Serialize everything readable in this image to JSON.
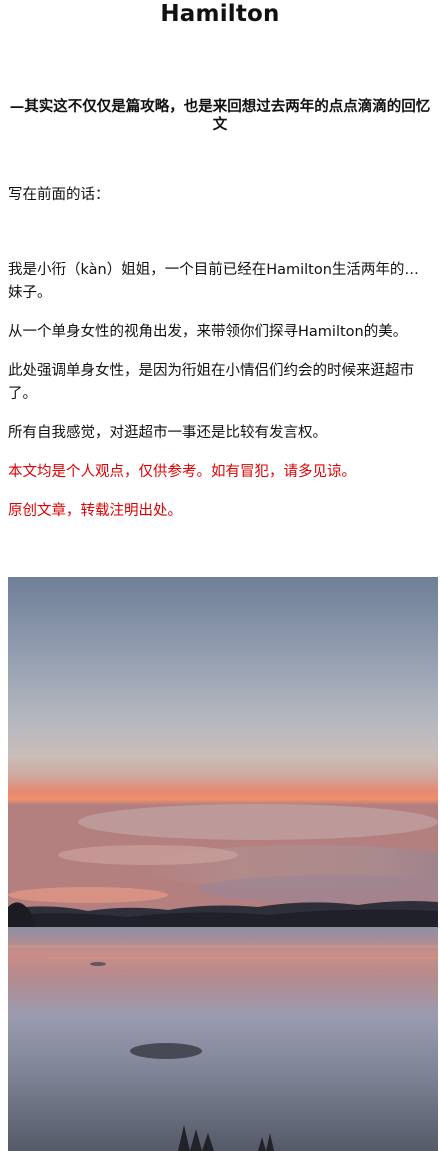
{
  "article": {
    "title": "Hamilton",
    "subtitle": "—其实这不仅仅是篇攻略，也是来回想过去两年的点点滴滴的回忆文",
    "paragraphs": [
      "写在前面的话：",
      "我是小衎（kàn）姐姐，一个目前已经在Hamilton生活两年的…妹子。",
      "从一个单身女性的视角出发，来带领你们探寻Hamilton的美。",
      "此处强调单身女性，是因为衎姐在小情侣们约会的时候来逛超市了。",
      "所有自我感觉，对逛超市一事还是比较有发言权。",
      "本文均是个人观点，仅供参考。如有冒犯，请多见谅。",
      "原创文章，转载注明出处。"
    ],
    "notice_color": "#e00000"
  }
}
